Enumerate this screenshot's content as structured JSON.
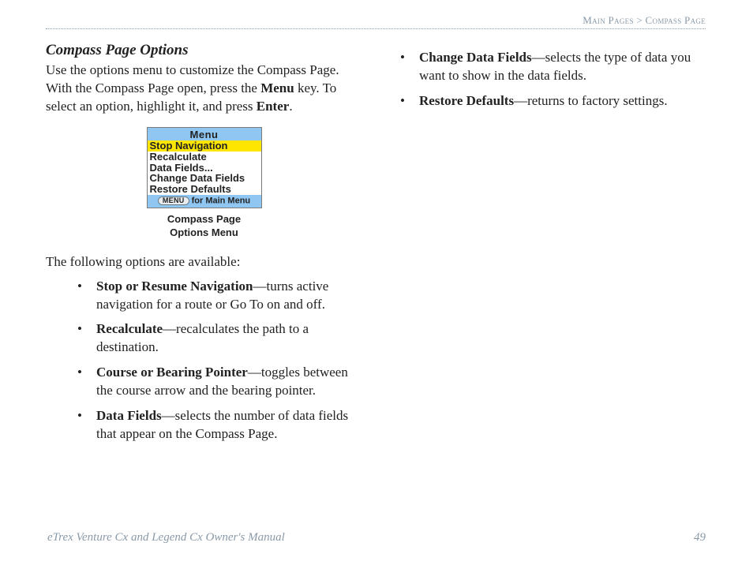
{
  "breadcrumb": {
    "left": "Main Pages",
    "sep": ">",
    "right": "Compass Page"
  },
  "section_title": "Compass Page Options",
  "intro": {
    "p1a": "Use the options menu to customize the Compass Page. With the Compass Page open, press the ",
    "p1b": "Menu",
    "p1c": " key. To select an option, highlight it, and press ",
    "p1d": "Enter",
    "p1e": "."
  },
  "device": {
    "header": "Menu",
    "rows": [
      {
        "text": "Stop Navigation",
        "highlight": true
      },
      {
        "text": "Recalculate",
        "highlight": false
      },
      {
        "text": "Data Fields...",
        "highlight": false
      },
      {
        "text": "Change Data Fields",
        "highlight": false
      },
      {
        "text": "Restore Defaults",
        "highlight": false
      }
    ],
    "footer_pill": "MENU",
    "footer_text": " for Main Menu"
  },
  "caption_l1": "Compass Page",
  "caption_l2": "Options Menu",
  "lead": "The following options are available:",
  "left_bullets": [
    {
      "bold": "Stop or Resume Navigation",
      "rest": "—turns active navigation for a route or Go To on and off."
    },
    {
      "bold": "Recalculate",
      "rest": "—recalculates the path to a destination."
    },
    {
      "bold": "Course or Bearing Pointer",
      "rest": "—toggles between the course arrow and the bearing pointer."
    },
    {
      "bold": "Data Fields",
      "rest": "—selects the number of data fields that appear on the Compass Page."
    }
  ],
  "right_bullets": [
    {
      "bold": "Change Data Fields",
      "rest": "—selects the type of data you want to show in the data fields."
    },
    {
      "bold": "Restore Defaults",
      "rest": "—returns to factory settings."
    }
  ],
  "footer": {
    "manual": "eTrex Venture Cx and Legend Cx Owner's Manual",
    "page": "49"
  }
}
